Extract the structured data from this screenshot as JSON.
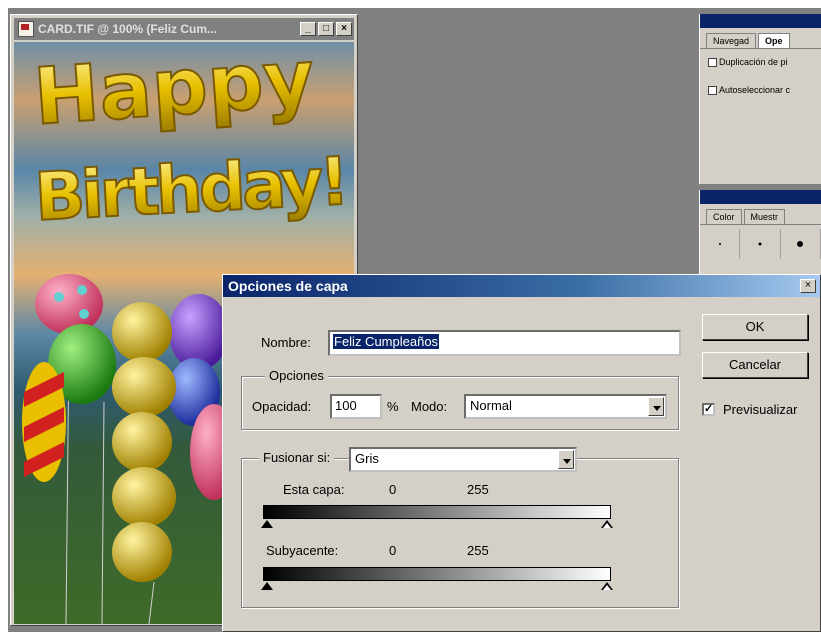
{
  "document": {
    "title": "CARD.TIF @ 100% (Feliz Cum...",
    "canvas_text": [
      "Happy",
      "Birthday!"
    ]
  },
  "panels": {
    "navigator": {
      "tabs": [
        "Navegad",
        "Ope"
      ],
      "options": [
        "Duplicación de pi",
        "Autoseleccionar c"
      ]
    },
    "color": {
      "tabs": [
        "Color",
        "Muestr"
      ]
    }
  },
  "dialog": {
    "title": "Opciones de capa",
    "name_label": "Nombre:",
    "name_value": "Feliz Cumpleaños",
    "ok_label": "OK",
    "cancel_label": "Cancelar",
    "preview_label": "Previsualizar",
    "preview_checked": true,
    "options_group_label": "Opciones",
    "opacity_label": "Opacidad:",
    "opacity_value": "100",
    "opacity_unit": "%",
    "mode_label": "Modo:",
    "mode_value": "Normal",
    "blend_if_label": "Fusionar si:",
    "blend_if_value": "Gris",
    "this_layer_label": "Esta capa:",
    "this_layer_min": "0",
    "this_layer_max": "255",
    "underlying_label": "Subyacente:",
    "underlying_min": "0",
    "underlying_max": "255"
  },
  "colors": {
    "title_bar_active": "#0a246a",
    "face": "#d4d0c8",
    "workspace": "#808080",
    "text_gold": "#e0b800"
  },
  "icons": [
    "photoshop-doc-icon",
    "minimize-icon",
    "maximize-icon",
    "close-icon",
    "dropdown-arrow-icon",
    "checkmark-icon",
    "slider-triangle-icon"
  ]
}
